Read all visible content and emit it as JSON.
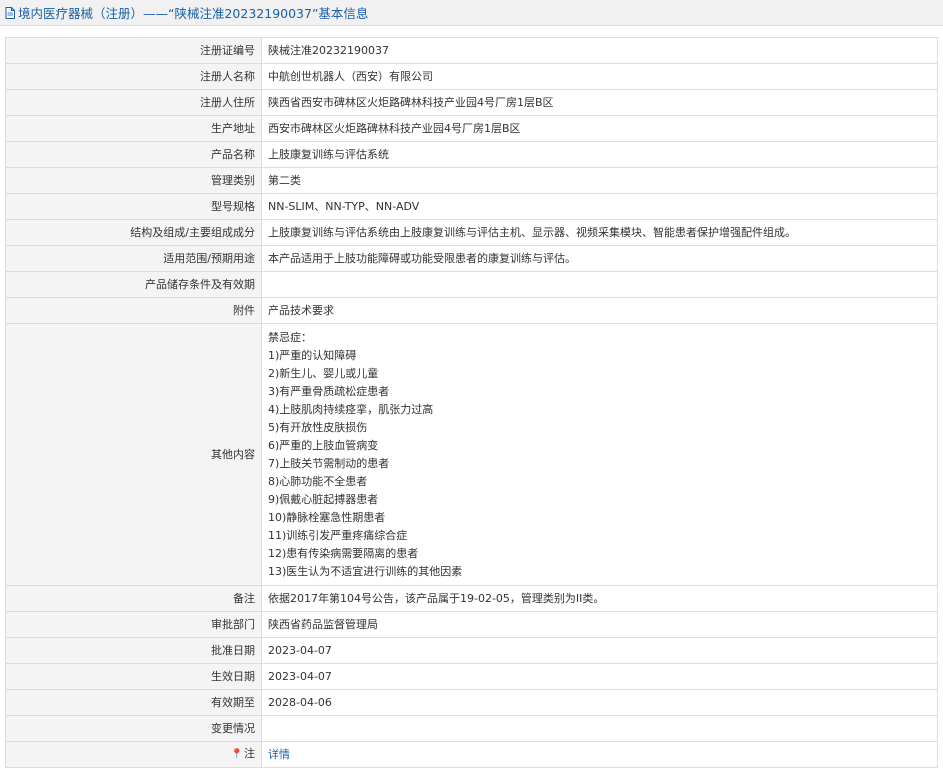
{
  "header": {
    "title": "境内医疗器械（注册）——“陕械注准20232190037”基本信息"
  },
  "rows": [
    {
      "label": "注册证编号",
      "value": "陕械注准20232190037"
    },
    {
      "label": "注册人名称",
      "value": "中航创世机器人（西安）有限公司"
    },
    {
      "label": "注册人住所",
      "value": "陕西省西安市碑林区火炬路碑林科技产业园4号厂房1层B区"
    },
    {
      "label": "生产地址",
      "value": "西安市碑林区火炬路碑林科技产业园4号厂房1层B区"
    },
    {
      "label": "产品名称",
      "value": "上肢康复训练与评估系统"
    },
    {
      "label": "管理类别",
      "value": "第二类"
    },
    {
      "label": "型号规格",
      "value": "NN-SLIM、NN-TYP、NN-ADV"
    },
    {
      "label": "结构及组成/主要组成成分",
      "value": "上肢康复训练与评估系统由上肢康复训练与评估主机、显示器、视频采集模块、智能患者保护增强配件组成。"
    },
    {
      "label": "适用范围/预期用途",
      "value": "本产品适用于上肢功能障碍或功能受限患者的康复训练与评估。"
    },
    {
      "label": "产品储存条件及有效期",
      "value": ""
    },
    {
      "label": "附件",
      "value": "产品技术要求"
    }
  ],
  "other": {
    "label": "其他内容",
    "lines": [
      "禁忌症：",
      "1)严重的认知障碍",
      "2)新生儿、婴儿或儿童",
      "3)有严重骨质疏松症患者",
      "4)上肢肌肉持续痉挛，肌张力过高",
      "5)有开放性皮肤损伤",
      "6)严重的上肢血管病变",
      "7)上肢关节需制动的患者",
      "8)心肺功能不全患者",
      "9)佩戴心脏起搏器患者",
      "10)静脉栓塞急性期患者",
      "11)训练引发严重疼痛综合症",
      "12)患有传染病需要隔离的患者",
      "13)医生认为不适宜进行训练的其他因素"
    ]
  },
  "rows2": [
    {
      "label": "备注",
      "value": "依据2017年第104号公告，该产品属于19-02-05，管理类别为II类。"
    },
    {
      "label": "审批部门",
      "value": "陕西省药品监督管理局"
    },
    {
      "label": "批准日期",
      "value": "2023-04-07"
    },
    {
      "label": "生效日期",
      "value": "2023-04-07"
    },
    {
      "label": "有效期至",
      "value": "2028-04-06"
    },
    {
      "label": "变更情况",
      "value": ""
    }
  ],
  "note": {
    "label": "注",
    "link": "详情"
  }
}
